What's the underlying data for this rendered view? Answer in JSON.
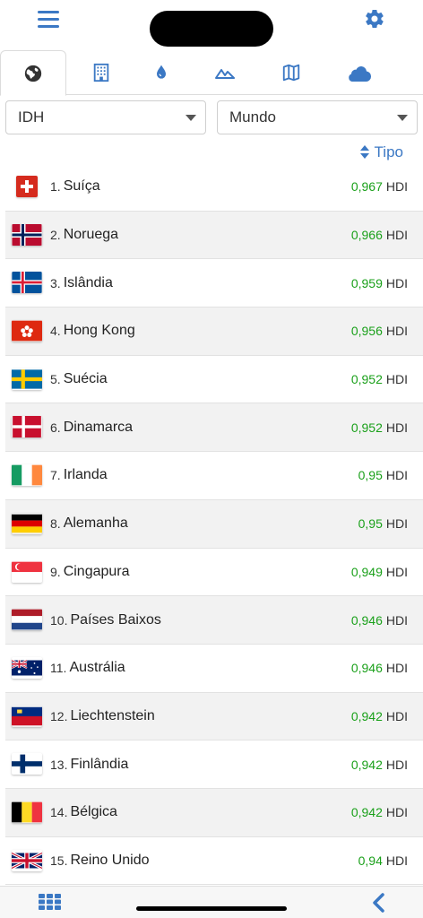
{
  "header": {
    "menu_icon": "hamburger-menu-icon",
    "settings_icon": "gear-icon"
  },
  "tabs": [
    {
      "icon": "globe-icon",
      "active": true
    },
    {
      "icon": "building-icon",
      "active": false
    },
    {
      "icon": "water-drop-icon",
      "active": false
    },
    {
      "icon": "mountains-icon",
      "active": false
    },
    {
      "icon": "map-icon",
      "active": false
    },
    {
      "icon": "cloud-icon",
      "active": false
    }
  ],
  "filters": {
    "indicator": "IDH",
    "region": "Mundo"
  },
  "sort": {
    "label": "Tipo"
  },
  "colors": {
    "accent": "#3b78c4",
    "value": "#1aa01a"
  },
  "rows": [
    {
      "num": "1.",
      "name": "Suíça",
      "value": "0,967",
      "unit": "HDI",
      "flag": "switzerland"
    },
    {
      "num": "2.",
      "name": "Noruega",
      "value": "0,966",
      "unit": "HDI",
      "flag": "norway"
    },
    {
      "num": "3.",
      "name": "Islândia",
      "value": "0,959",
      "unit": "HDI",
      "flag": "iceland"
    },
    {
      "num": "4.",
      "name": "Hong Kong",
      "value": "0,956",
      "unit": "HDI",
      "flag": "hongkong"
    },
    {
      "num": "5.",
      "name": "Suécia",
      "value": "0,952",
      "unit": "HDI",
      "flag": "sweden"
    },
    {
      "num": "6.",
      "name": "Dinamarca",
      "value": "0,952",
      "unit": "HDI",
      "flag": "denmark"
    },
    {
      "num": "7.",
      "name": "Irlanda",
      "value": "0,95",
      "unit": "HDI",
      "flag": "ireland"
    },
    {
      "num": "8.",
      "name": "Alemanha",
      "value": "0,95",
      "unit": "HDI",
      "flag": "germany"
    },
    {
      "num": "9.",
      "name": "Cingapura",
      "value": "0,949",
      "unit": "HDI",
      "flag": "singapore"
    },
    {
      "num": "10.",
      "name": "Países Baixos",
      "value": "0,946",
      "unit": "HDI",
      "flag": "netherlands"
    },
    {
      "num": "11.",
      "name": "Austrália",
      "value": "0,946",
      "unit": "HDI",
      "flag": "australia"
    },
    {
      "num": "12.",
      "name": "Liechtenstein",
      "value": "0,942",
      "unit": "HDI",
      "flag": "liechtenstein"
    },
    {
      "num": "13.",
      "name": "Finlândia",
      "value": "0,942",
      "unit": "HDI",
      "flag": "finland"
    },
    {
      "num": "14.",
      "name": "Bélgica",
      "value": "0,942",
      "unit": "HDI",
      "flag": "belgium"
    },
    {
      "num": "15.",
      "name": "Reino Unido",
      "value": "0,94",
      "unit": "HDI",
      "flag": "uk"
    }
  ],
  "footer": {
    "grid_icon": "grid-icon",
    "back_icon": "back-chevron-icon"
  }
}
